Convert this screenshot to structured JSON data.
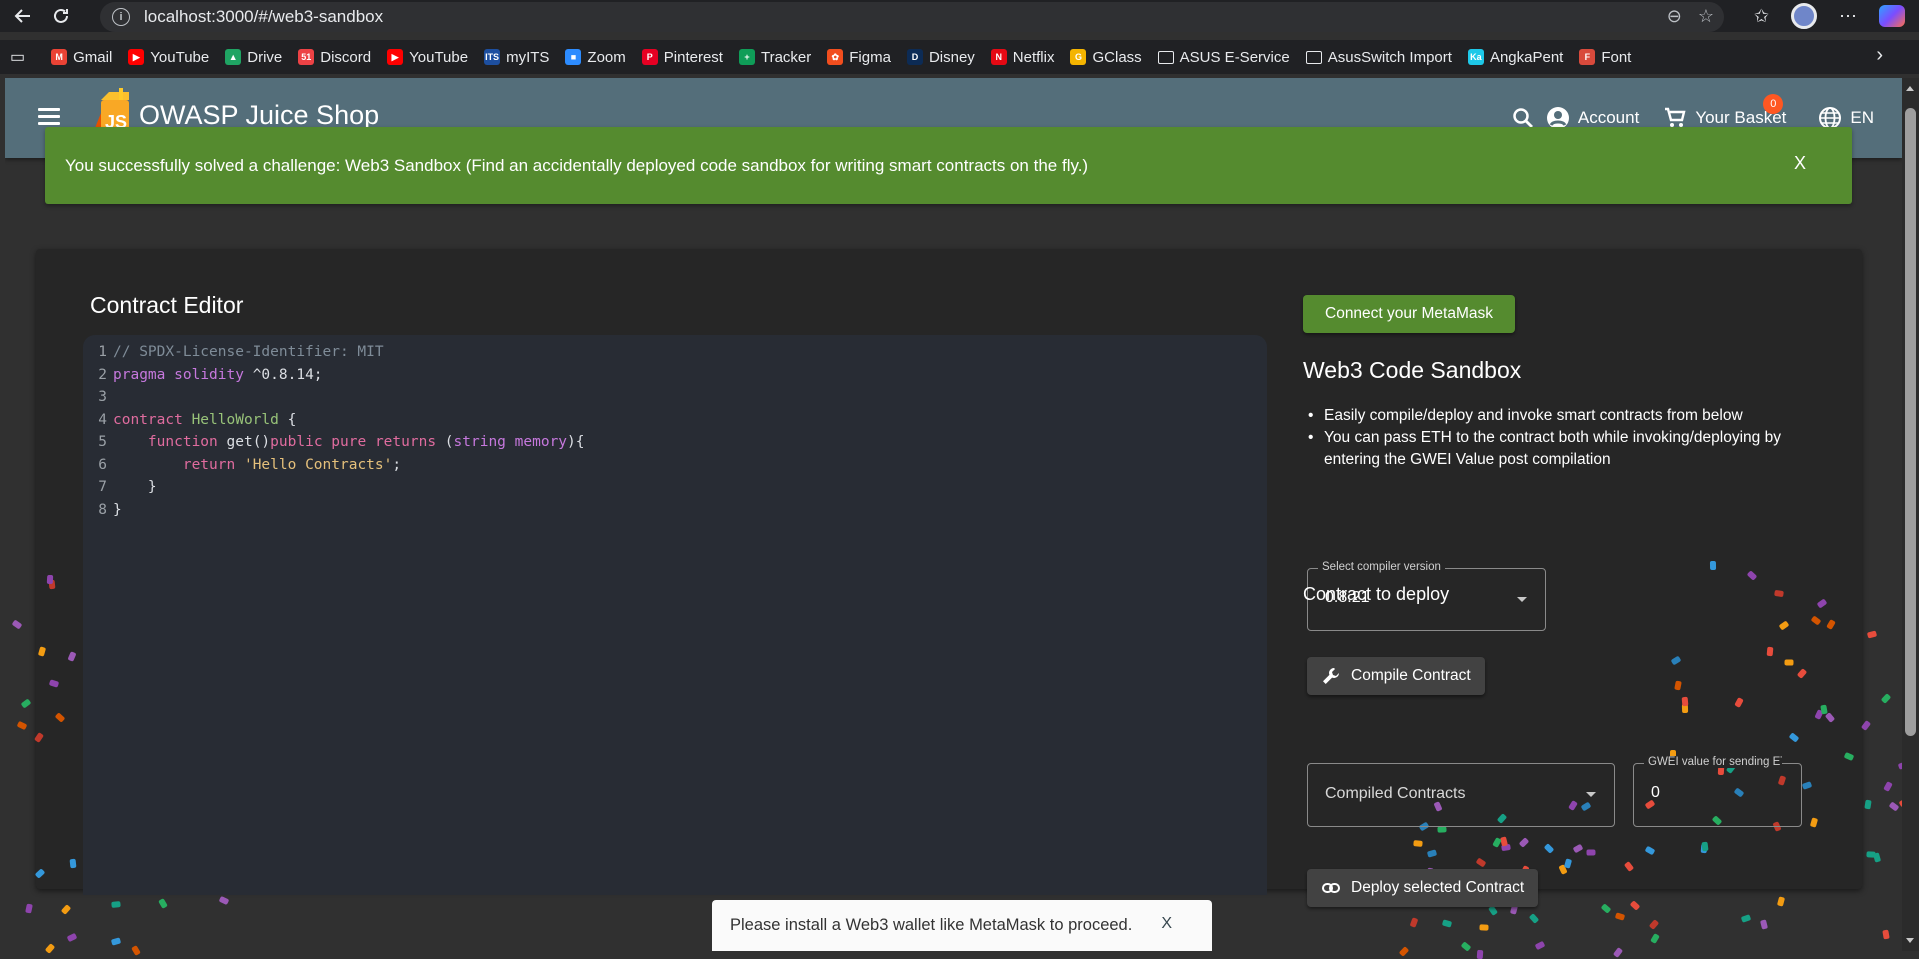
{
  "browser": {
    "url": "localhost:3000/#/web3-sandbox",
    "bookmarks": [
      {
        "label": "Gmail",
        "color": "#ea4335",
        "glyph": "M"
      },
      {
        "label": "YouTube",
        "color": "#ff0000",
        "glyph": "▶"
      },
      {
        "label": "Drive",
        "color": "#1fa463",
        "glyph": "▲"
      },
      {
        "label": "Discord",
        "color": "#ed4245",
        "glyph": "51"
      },
      {
        "label": "YouTube",
        "color": "#ff0000",
        "glyph": "▶"
      },
      {
        "label": "myITS",
        "color": "#1d4fa0",
        "glyph": "ITS"
      },
      {
        "label": "Zoom",
        "color": "#2d8cff",
        "glyph": "■"
      },
      {
        "label": "Pinterest",
        "color": "#e60023",
        "glyph": "P"
      },
      {
        "label": "Tracker",
        "color": "#0f9d58",
        "glyph": "+"
      },
      {
        "label": "Figma",
        "color": "#f24e1e",
        "glyph": "✿"
      },
      {
        "label": "Disney",
        "color": "#0c2b55",
        "glyph": "D"
      },
      {
        "label": "Netflix",
        "color": "#e50914",
        "glyph": "N"
      },
      {
        "label": "GClass",
        "color": "#f4b400",
        "glyph": "G"
      },
      {
        "label": "ASUS E-Service",
        "color": "folder",
        "glyph": ""
      },
      {
        "label": "AsusSwitch Import",
        "color": "folder",
        "glyph": ""
      },
      {
        "label": "AngkaPent",
        "color": "#1ec8e8",
        "glyph": "Ka"
      },
      {
        "label": "Font",
        "color": "#d84a3c",
        "glyph": "F"
      }
    ]
  },
  "app": {
    "title": "OWASP Juice Shop",
    "account_label": "Account",
    "basket_label": "Your Basket",
    "basket_count": "0",
    "language": "EN"
  },
  "banner": {
    "message": "You successfully solved a challenge: Web3 Sandbox (Find an accidentally deployed code sandbox for writing smart contracts on the fly.)",
    "close": "X"
  },
  "editor": {
    "title": "Contract Editor",
    "lines": [
      {
        "n": "1",
        "code": "// SPDX-License-Identifier: MIT"
      },
      {
        "n": "2",
        "code": "pragma solidity ^0.8.14;"
      },
      {
        "n": "3",
        "code": ""
      },
      {
        "n": "4",
        "code": "contract HelloWorld {"
      },
      {
        "n": "5",
        "code": "    function get()public pure returns (string memory){"
      },
      {
        "n": "6",
        "code": "        return 'Hello Contracts';"
      },
      {
        "n": "7",
        "code": "    }"
      },
      {
        "n": "8",
        "code": "}"
      }
    ]
  },
  "sandbox": {
    "connect_button": "Connect your MetaMask",
    "title": "Web3 Code Sandbox",
    "bullets": [
      "Easily compile/deploy and invoke smart contracts from below",
      "You can pass ETH to the contract both while invoking/deploying by entering the GWEI Value post compilation"
    ],
    "compiler_label": "Select compiler version",
    "compiler_value": "0.8.21",
    "compile_button": "Compile Contract",
    "deploy_title": "Contract to deploy",
    "contracts_placeholder": "Compiled Contracts",
    "gwei_label": "GWEI value for sending ETH",
    "gwei_value": "0",
    "deploy_button": "Deploy selected Contract"
  },
  "snackbar": {
    "message": "Please install a Web3 wallet like MetaMask to proceed.",
    "close": "X"
  }
}
